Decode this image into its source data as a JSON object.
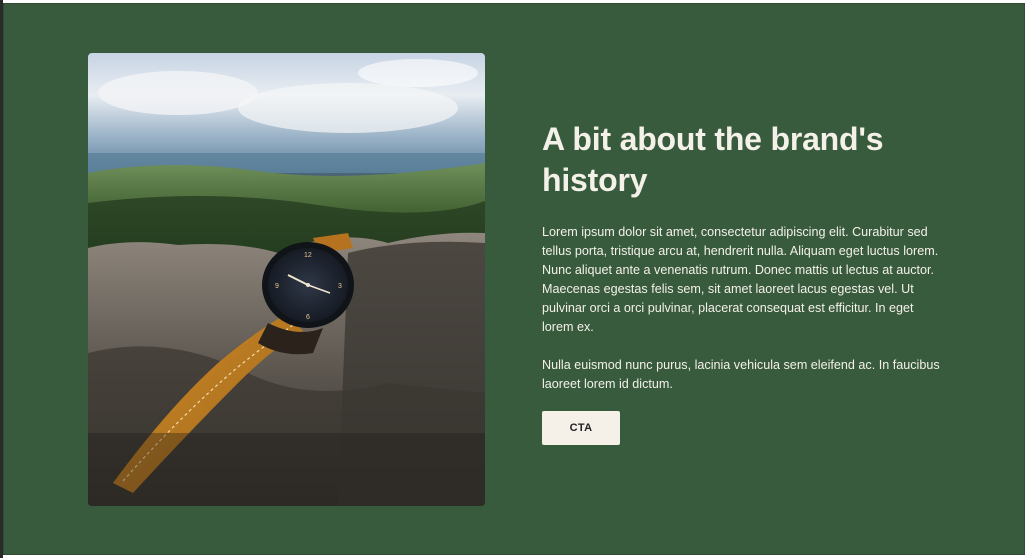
{
  "section": {
    "title": "A bit about the brand's history",
    "paragraphs": [
      "Lorem ipsum dolor sit amet, consectetur adipiscing elit. Curabitur sed tellus porta, tristique arcu at, hendrerit nulla. Aliquam eget luctus lorem. Nunc aliquet ante a venenatis rutrum. Donec mattis ut lectus at auctor. Maecenas egestas felis sem, sit amet laoreet lacus egestas vel. Ut pulvinar orci a orci pulvinar, placerat consequat est efficitur. In eget lorem ex.",
      "Nulla euismod nunc purus, lacinia vehicula sem eleifend ac. In faucibus laoreet lorem id dictum."
    ],
    "cta_label": "CTA"
  },
  "colors": {
    "background": "#385a3d",
    "text": "#f4f1e8",
    "button_bg": "#f5f0e8",
    "button_text": "#222222"
  },
  "image": {
    "icon": "wristwatch-photo"
  }
}
